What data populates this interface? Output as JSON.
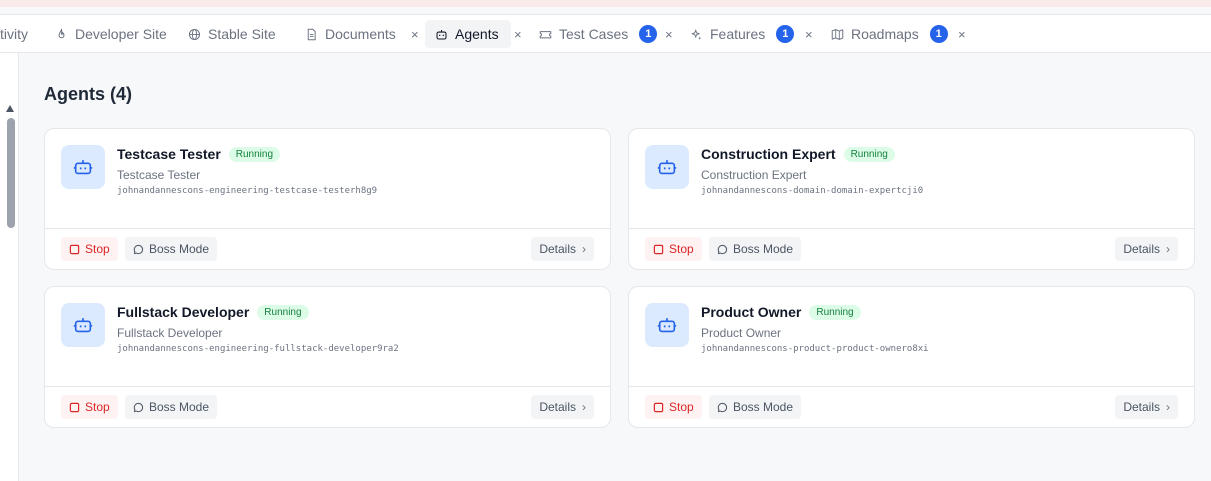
{
  "tabs": [
    {
      "label": "tivity"
    },
    {
      "label": "Developer Site",
      "icon": "flame-icon"
    },
    {
      "label": "Stable Site",
      "icon": "globe-icon"
    },
    {
      "label": "Documents",
      "icon": "document-icon"
    },
    {
      "label": "Agents",
      "icon": "bot-icon",
      "active": true
    },
    {
      "label": "Test Cases",
      "icon": "ticket-icon",
      "badge": "1"
    },
    {
      "label": "Features",
      "icon": "sparkles-icon",
      "badge": "1"
    },
    {
      "label": "Roadmaps",
      "icon": "map-icon",
      "badge": "1"
    }
  ],
  "close_glyph": "×",
  "page": {
    "title": "Agents (4)"
  },
  "agents": [
    {
      "name": "Testcase Tester",
      "status": "Running",
      "role": "Testcase Tester",
      "id": "johnandannescons-engineering-testcase-testerh8g9"
    },
    {
      "name": "Construction Expert",
      "status": "Running",
      "role": "Construction Expert",
      "id": "johnandannescons-domain-domain-expertcji0"
    },
    {
      "name": "Fullstack Developer",
      "status": "Running",
      "role": "Fullstack Developer",
      "id": "johnandannescons-engineering-fullstack-developer9ra2"
    },
    {
      "name": "Product Owner",
      "status": "Running",
      "role": "Product Owner",
      "id": "johnandannescons-product-product-ownero8xi"
    }
  ],
  "actions": {
    "stop": "Stop",
    "boss": "Boss Mode",
    "details": "Details",
    "chevron": "›"
  },
  "colors": {
    "accent": "#2563eb",
    "running_bg": "#dcfce7",
    "running_text": "#15803d",
    "stop": "#dc2626",
    "icon_bg": "#dbeafe"
  }
}
